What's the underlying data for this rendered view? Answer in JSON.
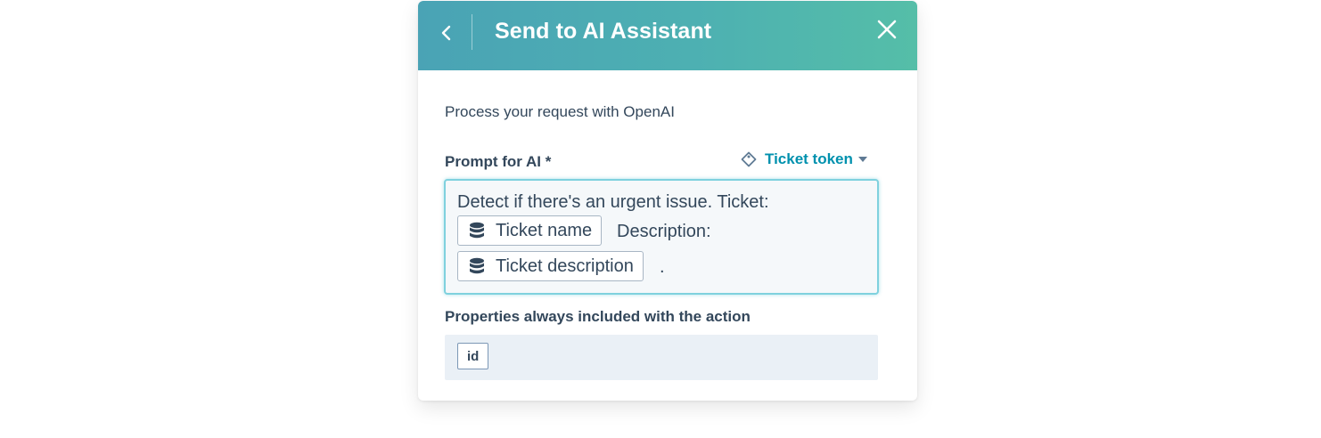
{
  "header": {
    "title": "Send to AI Assistant",
    "back_icon": "chevron-left-icon",
    "close_icon": "close-icon",
    "gradient": [
      "#4aa3b5",
      "#55bea8"
    ]
  },
  "body": {
    "description": "Process your request with OpenAI",
    "prompt": {
      "label": "Prompt for AI *",
      "token_menu_label": "Ticket token",
      "token_menu_icon": "tag-icon",
      "line1": "Detect if there's an urgent issue. Ticket:",
      "chip1": "Ticket name",
      "after_chip1": "Description:",
      "chip2": "Ticket description",
      "after_chip2": ".",
      "chip_icon": "database-icon"
    },
    "properties": {
      "label": "Properties always included with the action",
      "items": [
        "id"
      ]
    }
  },
  "colors": {
    "link": "#0091ae",
    "text": "#33475b",
    "focus_border": "#7fd1de"
  }
}
